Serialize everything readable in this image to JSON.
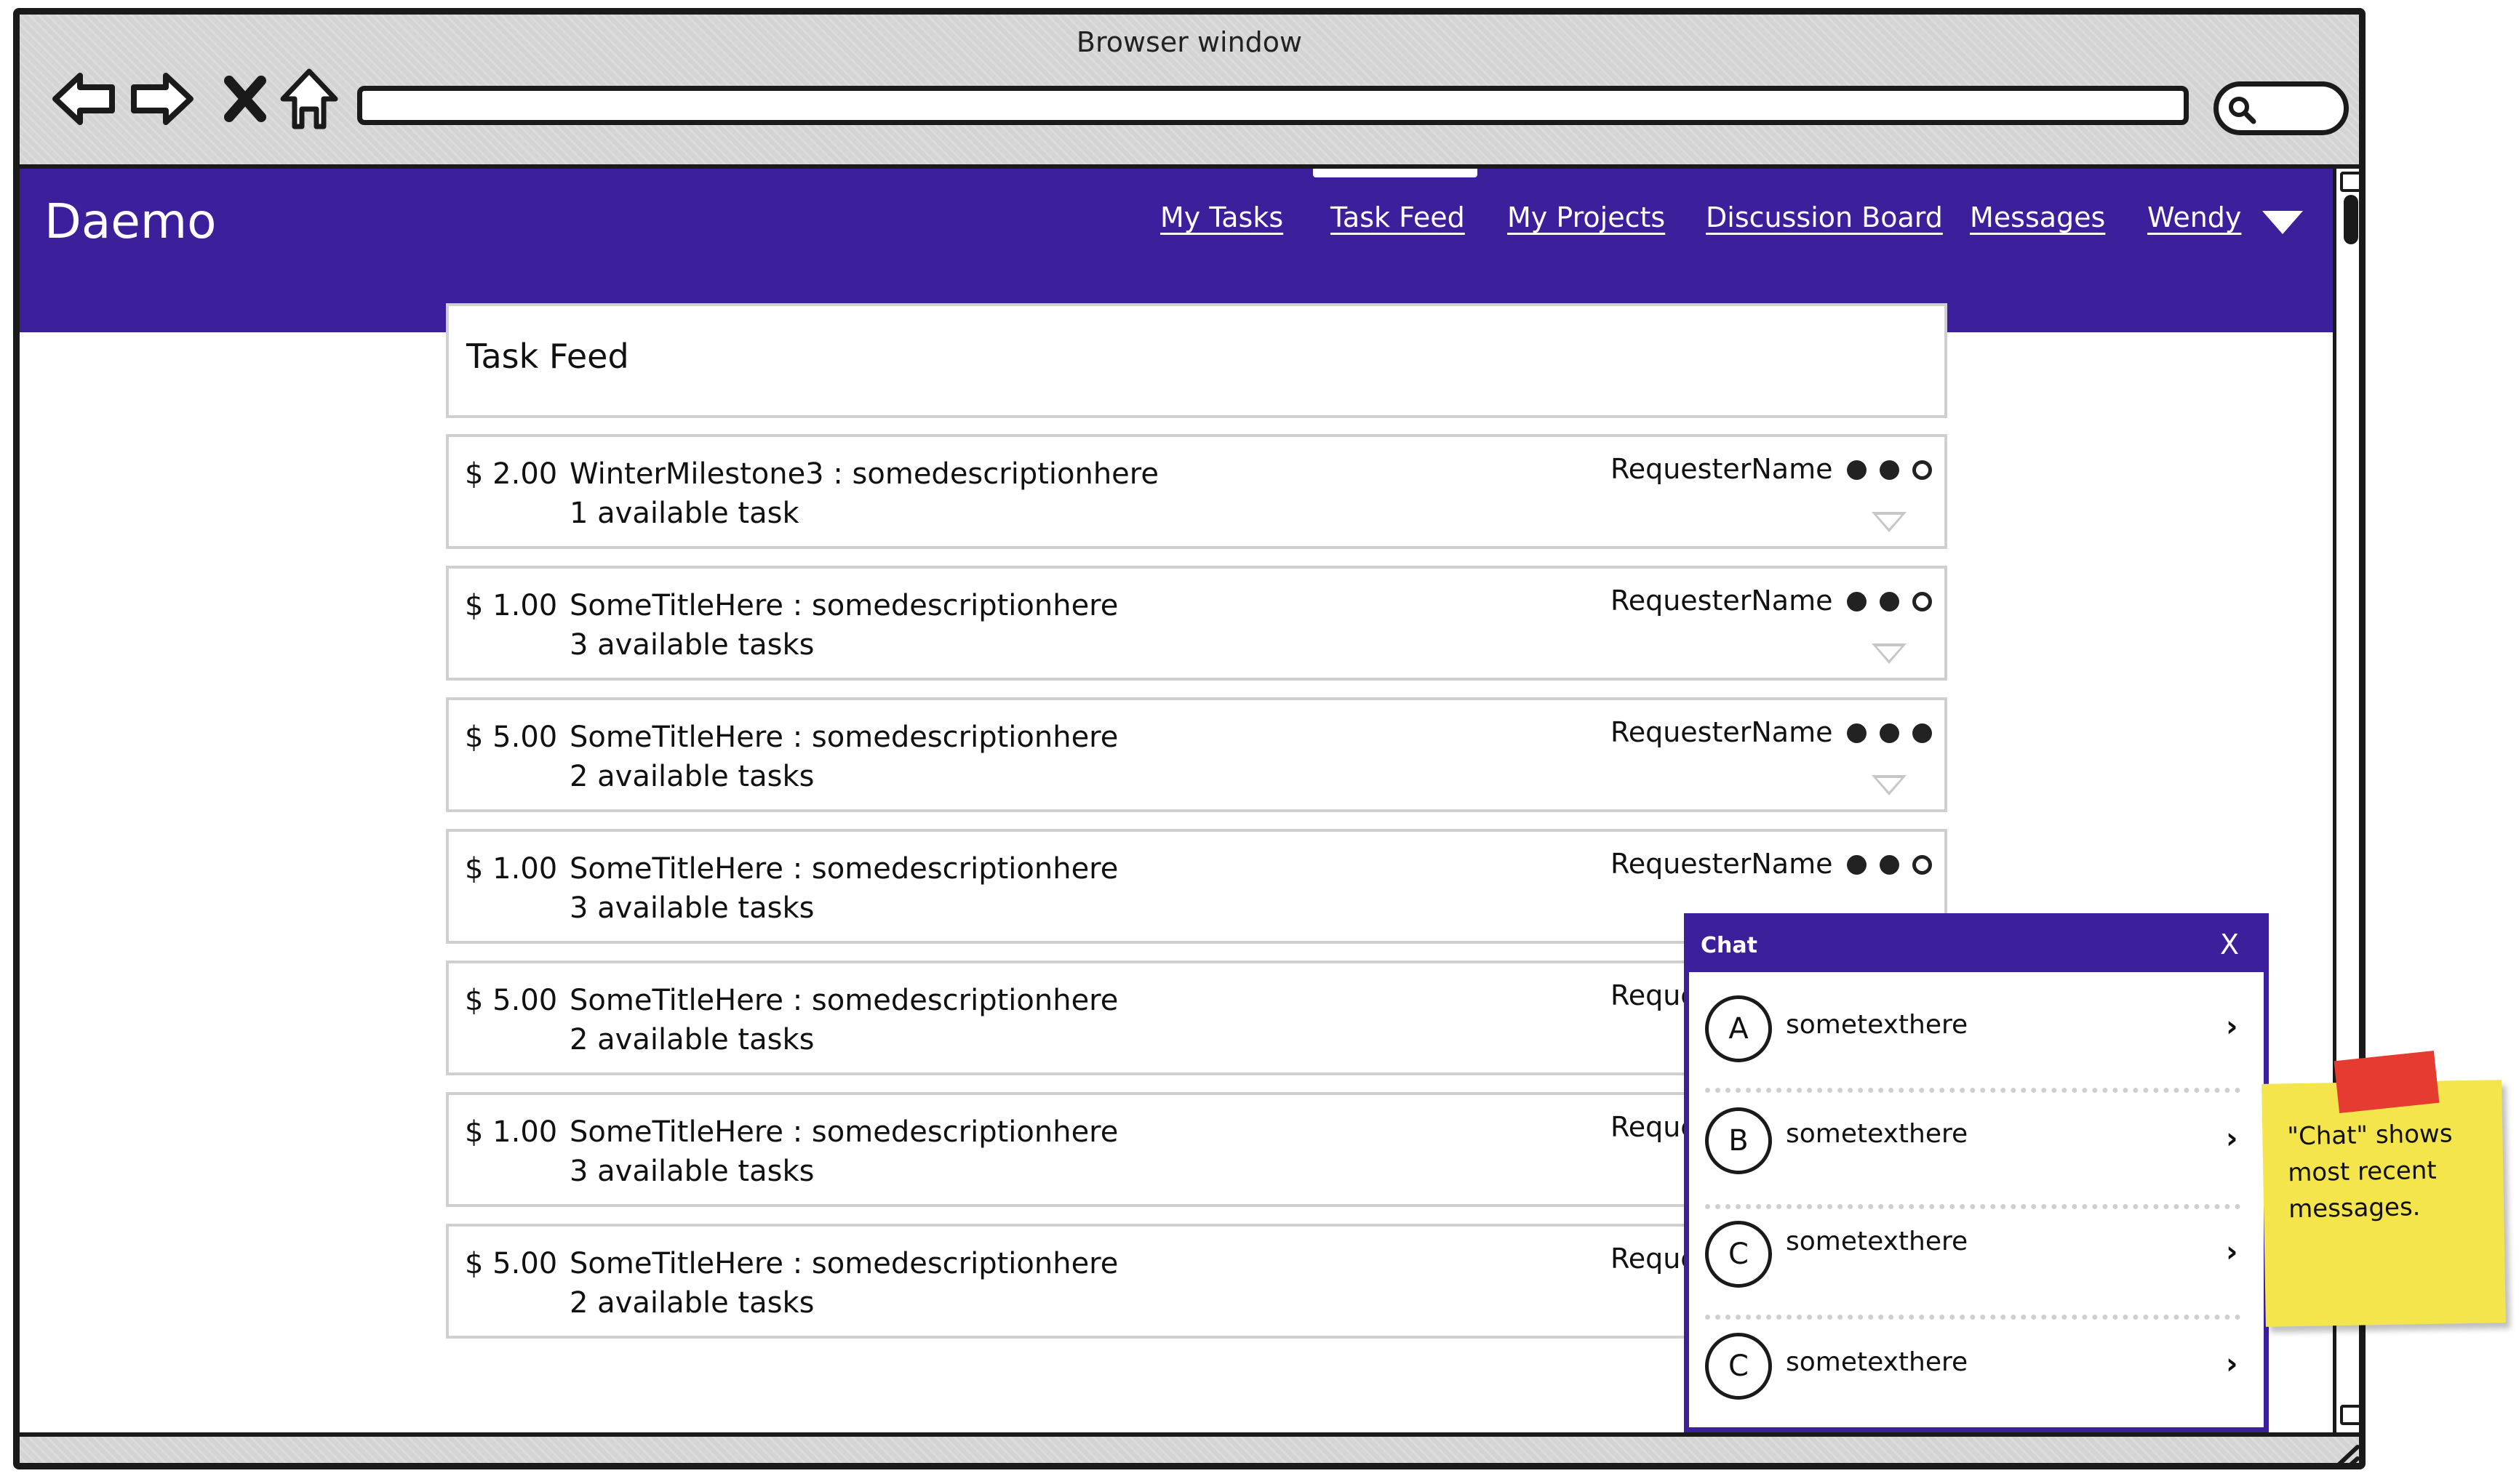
{
  "browser": {
    "window_title": "Browser window"
  },
  "app": {
    "brand": "Daemo",
    "nav": [
      {
        "label": "My Tasks"
      },
      {
        "label": "Task Feed"
      },
      {
        "label": "My Projects"
      },
      {
        "label": "Discussion Board"
      },
      {
        "label": "Messages"
      },
      {
        "label": "Wendy"
      }
    ],
    "active_nav": "Task Feed",
    "accent_color": "#3b1f9b"
  },
  "feed": {
    "title": "Task Feed",
    "tasks": [
      {
        "price": "$ 2.00",
        "title": "WinterMilestone3 : somedescriptionhere",
        "available": "1 available task",
        "requester": "RequesterName",
        "rating": 2
      },
      {
        "price": "$ 1.00",
        "title": "SomeTitleHere : somedescriptionhere",
        "available": "3 available tasks",
        "requester": "RequesterName",
        "rating": 2
      },
      {
        "price": "$ 5.00",
        "title": "SomeTitleHere : somedescriptionhere",
        "available": "2 available tasks",
        "requester": "RequesterName",
        "rating": 3
      },
      {
        "price": "$ 1.00",
        "title": "SomeTitleHere : somedescriptionhere",
        "available": "3 available tasks",
        "requester": "RequesterName",
        "rating": 2
      },
      {
        "price": "$ 5.00",
        "title": "SomeTitleHere : somedescriptionhere",
        "available": "2 available tasks",
        "requester": "RequesterName"
      },
      {
        "price": "$ 1.00",
        "title": "SomeTitleHere : somedescriptionhere",
        "available": "3 available tasks",
        "requester": "RequesterName"
      },
      {
        "price": "$ 5.00",
        "title": "SomeTitleHere : somedescriptionhere",
        "available": "2 available tasks",
        "requester": "RequesterName"
      }
    ]
  },
  "chat": {
    "title": "Chat",
    "close_label": "X",
    "items": [
      {
        "avatar": "A",
        "text": "sometexthere"
      },
      {
        "avatar": "B",
        "text": "sometexthere"
      },
      {
        "avatar": "C",
        "text": "sometexthere"
      },
      {
        "avatar": "C",
        "text": "sometexthere"
      }
    ]
  },
  "note": {
    "text": "\"Chat\" shows most recent messages."
  }
}
